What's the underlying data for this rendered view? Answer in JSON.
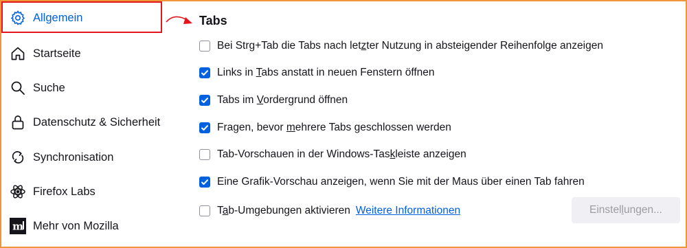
{
  "sidebar": {
    "items": [
      {
        "label": "Allgemein",
        "icon": "gear-icon",
        "active": true
      },
      {
        "label": "Startseite",
        "icon": "home-icon"
      },
      {
        "label": "Suche",
        "icon": "search-icon"
      },
      {
        "label": "Datenschutz & Sicherheit",
        "icon": "lock-icon"
      },
      {
        "label": "Synchronisation",
        "icon": "sync-icon"
      },
      {
        "label": "Firefox Labs",
        "icon": "labs-icon"
      },
      {
        "label": "Mehr von Mozilla",
        "icon": "mozilla-icon"
      }
    ]
  },
  "main": {
    "section_title": "Tabs",
    "options": [
      {
        "before": "Bei Strg+Tab die Tabs nach let",
        "key": "z",
        "after": "ter Nutzung in absteigender Reihenfolge anzeigen",
        "checked": false
      },
      {
        "before": "Links in ",
        "key": "T",
        "after": "abs anstatt in neuen Fenstern öffnen",
        "checked": true
      },
      {
        "before": "Tabs im ",
        "key": "V",
        "after": "ordergrund öffnen",
        "checked": true
      },
      {
        "before": "Fragen, bevor ",
        "key": "m",
        "after": "ehrere Tabs geschlossen werden",
        "checked": true
      },
      {
        "before": "Tab-Vorschauen in der Windows-Tas",
        "key": "k",
        "after": "leiste anzeigen",
        "checked": false
      },
      {
        "before": "Eine Grafik-Vorschau anzeigen, wenn Sie mit der Maus über einen Tab fahren",
        "key": "",
        "after": "",
        "checked": true
      },
      {
        "before": "T",
        "key": "a",
        "after": "b-Umgebungen aktivieren",
        "checked": false
      }
    ],
    "more_info_link": "Weitere Informationen",
    "settings_button": {
      "before": "Einstel",
      "key": "l",
      "after": "ungen..."
    }
  },
  "colors": {
    "accent": "#0061e0",
    "highlight_box": "#e3161d",
    "frame": "#f0963a"
  }
}
